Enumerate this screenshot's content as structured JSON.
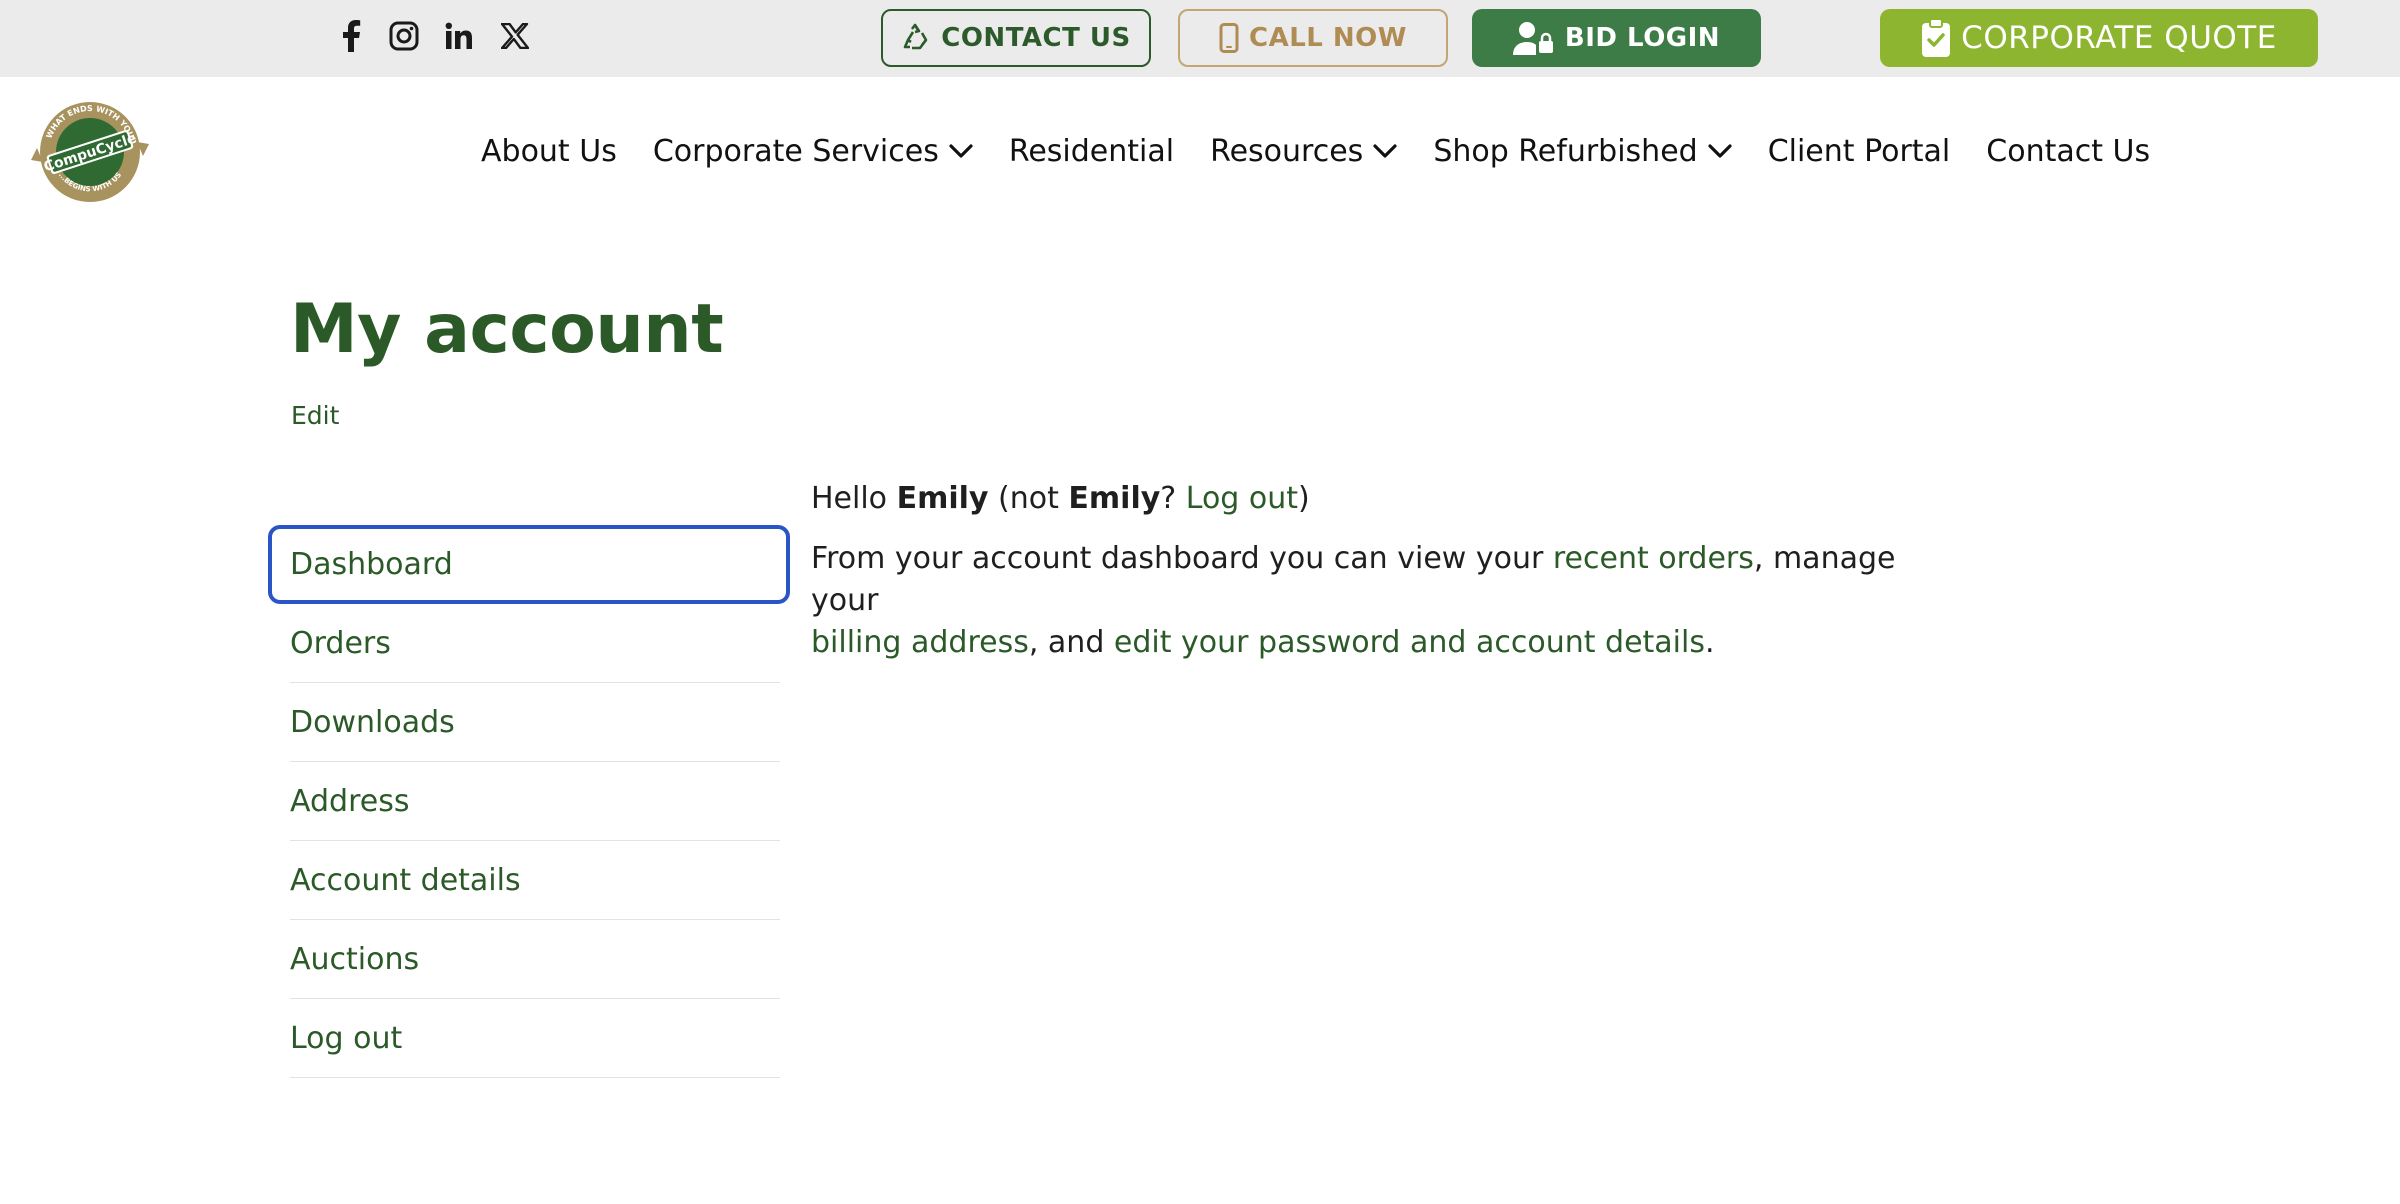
{
  "topbar": {
    "social": [
      {
        "name": "facebook-icon"
      },
      {
        "name": "instagram-icon"
      },
      {
        "name": "linkedin-icon"
      },
      {
        "name": "x-twitter-icon"
      }
    ],
    "contact_label": "CONTACT US",
    "call_label": "CALL NOW",
    "bid_label": "BID LOGIN",
    "quote_label": "CORPORATE QUOTE"
  },
  "logo": {
    "top_text": "WHAT ENDS WITH YOU",
    "brand": "CompuCycle",
    "bottom_text": "...BEGINS WITH US"
  },
  "nav": {
    "items": [
      {
        "label": "About Us",
        "dropdown": false
      },
      {
        "label": "Corporate Services",
        "dropdown": true
      },
      {
        "label": "Residential",
        "dropdown": false
      },
      {
        "label": "Resources",
        "dropdown": true
      },
      {
        "label": "Shop Refurbished",
        "dropdown": true
      },
      {
        "label": "Client Portal",
        "dropdown": false
      },
      {
        "label": "Contact Us",
        "dropdown": false
      }
    ]
  },
  "page": {
    "title": "My account",
    "edit_label": "Edit"
  },
  "account_nav": {
    "items": [
      "Dashboard",
      "Orders",
      "Downloads",
      "Address",
      "Account details",
      "Auctions",
      "Log out"
    ],
    "active": "Dashboard"
  },
  "content": {
    "hello": "Hello",
    "user": "Emily",
    "not": "(not",
    "q": "?",
    "logout": "Log out",
    "close": ")",
    "intro": "From your account dashboard you can view your",
    "recent_orders": "recent orders",
    "manage": ", manage your",
    "billing": "billing address",
    "and": ", and",
    "edit_details": "edit your password and account details",
    "period": "."
  },
  "colors": {
    "brand_green": "#2b5a28",
    "bid_green": "#3d7c46",
    "quote_green": "#8db52f",
    "call_gold": "#b08c55",
    "focus_blue": "#2a55c4"
  }
}
